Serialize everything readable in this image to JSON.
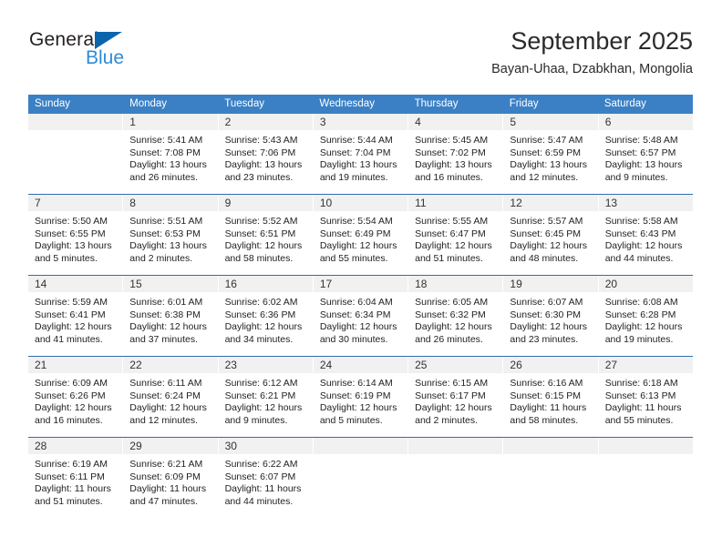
{
  "brand": {
    "name_top": "General",
    "name_bottom": "Blue",
    "triangle_color": "#0c64ad",
    "blue_text_color": "#2e8bd8"
  },
  "header": {
    "title": "September 2025",
    "subtitle": "Bayan-Uhaa, Dzabkhan, Mongolia"
  },
  "theme": {
    "header_row_bg": "#3b80c4",
    "day_number_bg": "#f1f1f1",
    "week_divider": "#2f6ea8"
  },
  "calendar": {
    "weekday_headers": [
      "Sunday",
      "Monday",
      "Tuesday",
      "Wednesday",
      "Thursday",
      "Friday",
      "Saturday"
    ],
    "weeks": [
      [
        {
          "day": "",
          "sunrise": "",
          "sunset": "",
          "daylight_line1": "",
          "daylight_line2": "",
          "empty": true
        },
        {
          "day": "1",
          "sunrise": "Sunrise: 5:41 AM",
          "sunset": "Sunset: 7:08 PM",
          "daylight_line1": "Daylight: 13 hours",
          "daylight_line2": "and 26 minutes."
        },
        {
          "day": "2",
          "sunrise": "Sunrise: 5:43 AM",
          "sunset": "Sunset: 7:06 PM",
          "daylight_line1": "Daylight: 13 hours",
          "daylight_line2": "and 23 minutes."
        },
        {
          "day": "3",
          "sunrise": "Sunrise: 5:44 AM",
          "sunset": "Sunset: 7:04 PM",
          "daylight_line1": "Daylight: 13 hours",
          "daylight_line2": "and 19 minutes."
        },
        {
          "day": "4",
          "sunrise": "Sunrise: 5:45 AM",
          "sunset": "Sunset: 7:02 PM",
          "daylight_line1": "Daylight: 13 hours",
          "daylight_line2": "and 16 minutes."
        },
        {
          "day": "5",
          "sunrise": "Sunrise: 5:47 AM",
          "sunset": "Sunset: 6:59 PM",
          "daylight_line1": "Daylight: 13 hours",
          "daylight_line2": "and 12 minutes."
        },
        {
          "day": "6",
          "sunrise": "Sunrise: 5:48 AM",
          "sunset": "Sunset: 6:57 PM",
          "daylight_line1": "Daylight: 13 hours",
          "daylight_line2": "and 9 minutes."
        }
      ],
      [
        {
          "day": "7",
          "sunrise": "Sunrise: 5:50 AM",
          "sunset": "Sunset: 6:55 PM",
          "daylight_line1": "Daylight: 13 hours",
          "daylight_line2": "and 5 minutes."
        },
        {
          "day": "8",
          "sunrise": "Sunrise: 5:51 AM",
          "sunset": "Sunset: 6:53 PM",
          "daylight_line1": "Daylight: 13 hours",
          "daylight_line2": "and 2 minutes."
        },
        {
          "day": "9",
          "sunrise": "Sunrise: 5:52 AM",
          "sunset": "Sunset: 6:51 PM",
          "daylight_line1": "Daylight: 12 hours",
          "daylight_line2": "and 58 minutes."
        },
        {
          "day": "10",
          "sunrise": "Sunrise: 5:54 AM",
          "sunset": "Sunset: 6:49 PM",
          "daylight_line1": "Daylight: 12 hours",
          "daylight_line2": "and 55 minutes."
        },
        {
          "day": "11",
          "sunrise": "Sunrise: 5:55 AM",
          "sunset": "Sunset: 6:47 PM",
          "daylight_line1": "Daylight: 12 hours",
          "daylight_line2": "and 51 minutes."
        },
        {
          "day": "12",
          "sunrise": "Sunrise: 5:57 AM",
          "sunset": "Sunset: 6:45 PM",
          "daylight_line1": "Daylight: 12 hours",
          "daylight_line2": "and 48 minutes."
        },
        {
          "day": "13",
          "sunrise": "Sunrise: 5:58 AM",
          "sunset": "Sunset: 6:43 PM",
          "daylight_line1": "Daylight: 12 hours",
          "daylight_line2": "and 44 minutes."
        }
      ],
      [
        {
          "day": "14",
          "sunrise": "Sunrise: 5:59 AM",
          "sunset": "Sunset: 6:41 PM",
          "daylight_line1": "Daylight: 12 hours",
          "daylight_line2": "and 41 minutes."
        },
        {
          "day": "15",
          "sunrise": "Sunrise: 6:01 AM",
          "sunset": "Sunset: 6:38 PM",
          "daylight_line1": "Daylight: 12 hours",
          "daylight_line2": "and 37 minutes."
        },
        {
          "day": "16",
          "sunrise": "Sunrise: 6:02 AM",
          "sunset": "Sunset: 6:36 PM",
          "daylight_line1": "Daylight: 12 hours",
          "daylight_line2": "and 34 minutes."
        },
        {
          "day": "17",
          "sunrise": "Sunrise: 6:04 AM",
          "sunset": "Sunset: 6:34 PM",
          "daylight_line1": "Daylight: 12 hours",
          "daylight_line2": "and 30 minutes."
        },
        {
          "day": "18",
          "sunrise": "Sunrise: 6:05 AM",
          "sunset": "Sunset: 6:32 PM",
          "daylight_line1": "Daylight: 12 hours",
          "daylight_line2": "and 26 minutes."
        },
        {
          "day": "19",
          "sunrise": "Sunrise: 6:07 AM",
          "sunset": "Sunset: 6:30 PM",
          "daylight_line1": "Daylight: 12 hours",
          "daylight_line2": "and 23 minutes."
        },
        {
          "day": "20",
          "sunrise": "Sunrise: 6:08 AM",
          "sunset": "Sunset: 6:28 PM",
          "daylight_line1": "Daylight: 12 hours",
          "daylight_line2": "and 19 minutes."
        }
      ],
      [
        {
          "day": "21",
          "sunrise": "Sunrise: 6:09 AM",
          "sunset": "Sunset: 6:26 PM",
          "daylight_line1": "Daylight: 12 hours",
          "daylight_line2": "and 16 minutes."
        },
        {
          "day": "22",
          "sunrise": "Sunrise: 6:11 AM",
          "sunset": "Sunset: 6:24 PM",
          "daylight_line1": "Daylight: 12 hours",
          "daylight_line2": "and 12 minutes."
        },
        {
          "day": "23",
          "sunrise": "Sunrise: 6:12 AM",
          "sunset": "Sunset: 6:21 PM",
          "daylight_line1": "Daylight: 12 hours",
          "daylight_line2": "and 9 minutes."
        },
        {
          "day": "24",
          "sunrise": "Sunrise: 6:14 AM",
          "sunset": "Sunset: 6:19 PM",
          "daylight_line1": "Daylight: 12 hours",
          "daylight_line2": "and 5 minutes."
        },
        {
          "day": "25",
          "sunrise": "Sunrise: 6:15 AM",
          "sunset": "Sunset: 6:17 PM",
          "daylight_line1": "Daylight: 12 hours",
          "daylight_line2": "and 2 minutes."
        },
        {
          "day": "26",
          "sunrise": "Sunrise: 6:16 AM",
          "sunset": "Sunset: 6:15 PM",
          "daylight_line1": "Daylight: 11 hours",
          "daylight_line2": "and 58 minutes."
        },
        {
          "day": "27",
          "sunrise": "Sunrise: 6:18 AM",
          "sunset": "Sunset: 6:13 PM",
          "daylight_line1": "Daylight: 11 hours",
          "daylight_line2": "and 55 minutes."
        }
      ],
      [
        {
          "day": "28",
          "sunrise": "Sunrise: 6:19 AM",
          "sunset": "Sunset: 6:11 PM",
          "daylight_line1": "Daylight: 11 hours",
          "daylight_line2": "and 51 minutes."
        },
        {
          "day": "29",
          "sunrise": "Sunrise: 6:21 AM",
          "sunset": "Sunset: 6:09 PM",
          "daylight_line1": "Daylight: 11 hours",
          "daylight_line2": "and 47 minutes."
        },
        {
          "day": "30",
          "sunrise": "Sunrise: 6:22 AM",
          "sunset": "Sunset: 6:07 PM",
          "daylight_line1": "Daylight: 11 hours",
          "daylight_line2": "and 44 minutes."
        },
        {
          "day": "",
          "sunrise": "",
          "sunset": "",
          "daylight_line1": "",
          "daylight_line2": "",
          "empty": true
        },
        {
          "day": "",
          "sunrise": "",
          "sunset": "",
          "daylight_line1": "",
          "daylight_line2": "",
          "empty": true
        },
        {
          "day": "",
          "sunrise": "",
          "sunset": "",
          "daylight_line1": "",
          "daylight_line2": "",
          "empty": true
        },
        {
          "day": "",
          "sunrise": "",
          "sunset": "",
          "daylight_line1": "",
          "daylight_line2": "",
          "empty": true
        }
      ]
    ]
  }
}
